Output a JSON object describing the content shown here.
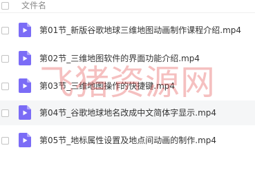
{
  "header": {
    "column_label": "文件名"
  },
  "files": [
    {
      "name": "第01节_新版谷歌地球三维地图动画制作课程介绍.mp4",
      "icon": "video-file-icon"
    },
    {
      "name": "第02节_三维地图软件的界面功能介绍.mp4",
      "icon": "video-file-icon"
    },
    {
      "name": "第03节_三维地图操作的快捷键.mp4",
      "icon": "video-file-icon"
    },
    {
      "name": "第04节_谷歌地球地名改成中文简体字显示.mp4",
      "icon": "video-file-icon"
    },
    {
      "name": "第05节_地标属性设置及地点间动画的制作.mp4",
      "icon": "video-file-icon"
    }
  ],
  "watermark": {
    "text": "飞猪资源网"
  },
  "colors": {
    "icon_purple": "#7b6cf6",
    "hover_row": "#f5f6f7",
    "watermark_red": "#e03c3c"
  }
}
